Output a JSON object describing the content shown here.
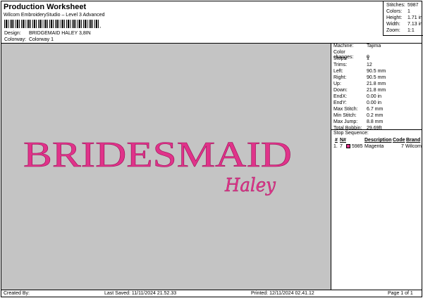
{
  "header": {
    "title": "Production Worksheet",
    "subtitle": "Wilcom EmbroideryStudio – Level 3 Advanced",
    "design_label": "Design:",
    "design_value": "BRIDGEMAID HALEY 3,8IN",
    "colorway_label": "Colorway:",
    "colorway_value": "Colorway 1"
  },
  "stats": {
    "stitches_label": "Stitches:",
    "stitches_value": "5987",
    "colors_label": "Colors:",
    "colors_value": "1",
    "height_label": "Height:",
    "height_value": "1.71 in",
    "width_label": "Width:",
    "width_value": "7.13 in",
    "zoom_label": "Zoom:",
    "zoom_value": "1:1"
  },
  "preview": {
    "main_text": "BRIDESMAID",
    "script_text": "Haley",
    "thread_color": "#e0338a",
    "background": "#c4c4c4"
  },
  "info": [
    {
      "label": "Machine:",
      "value": "Tajima"
    },
    {
      "label": "Color changes:",
      "value": "0"
    },
    {
      "label": "Stops:",
      "value": "1"
    },
    {
      "label": "Trims:",
      "value": "12"
    },
    {
      "label": "Left:",
      "value": "90.5 mm"
    },
    {
      "label": "Right:",
      "value": "90.5 mm"
    },
    {
      "label": "Up:",
      "value": "21.8 mm"
    },
    {
      "label": "Down:",
      "value": "21.8 mm"
    },
    {
      "label": "EndX:",
      "value": "0.00 in"
    },
    {
      "label": "EndY:",
      "value": "0.00 in"
    },
    {
      "label": "Max Stitch:",
      "value": "6.7 mm"
    },
    {
      "label": "Min Stitch:",
      "value": "0.2 mm"
    },
    {
      "label": "Max Jump:",
      "value": "8.8 mm"
    },
    {
      "label": "Total Bobbin:",
      "value": "29.69ft"
    }
  ],
  "stop_sequence": {
    "title": "Stop Sequence:",
    "headers": [
      "#",
      "N#",
      "",
      "Description",
      "Code",
      "Brand"
    ],
    "rows": [
      {
        "num": "1.",
        "n": "7",
        "stitches": "5985",
        "description": "Magenta",
        "code": "7",
        "brand": "Wilcom"
      }
    ]
  },
  "footer": {
    "created_by": "Created By:",
    "last_saved": "Last Saved: 11/11/2024 21.52.33",
    "printed": "Printed: 12/11/2024 02.41.12",
    "page": "Page 1 of 1"
  }
}
